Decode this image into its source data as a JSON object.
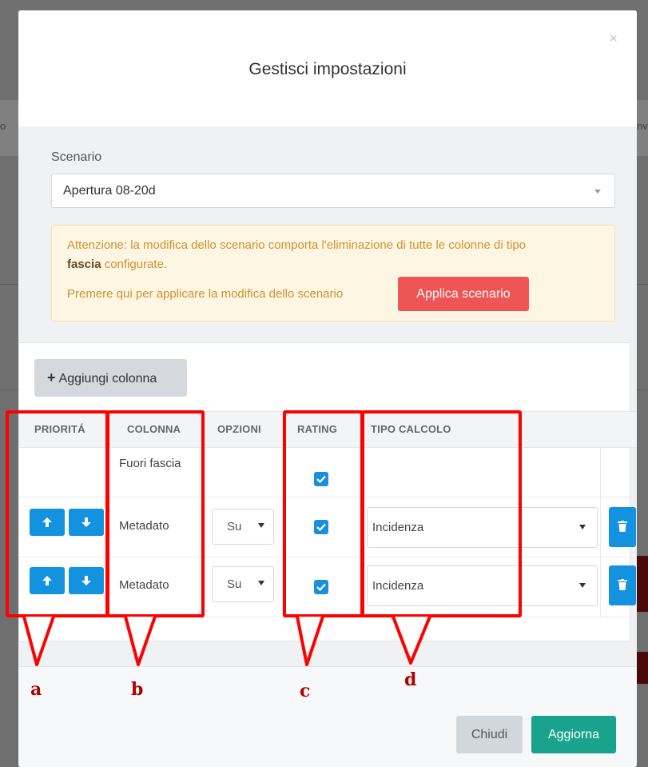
{
  "modal": {
    "title": "Gestisci impostazioni",
    "close_glyph": "×"
  },
  "scenario": {
    "label": "Scenario",
    "selected": "Apertura 08-20d"
  },
  "alert": {
    "text_before": "Attenzione: la modifica dello scenario comporta l'eliminazione di tutte le colonne di tipo",
    "bold_word": "fascia",
    "text_after": " configurate.",
    "apply_prompt": "Premere qui per applicare la modifica dello scenario",
    "apply_button": "Applica scenario"
  },
  "toolbar": {
    "add_column_label": "Aggiungi colonna"
  },
  "table": {
    "headers": [
      "PRIORITÁ",
      "COLONNA",
      "OPZIONI",
      "RATING",
      "TIPO CALCOLO"
    ],
    "rows": [
      {
        "column": "Fuori fascia",
        "option": "",
        "rating_checked": true,
        "calc_type": ""
      },
      {
        "column": "Metadato",
        "option": "Su",
        "rating_checked": true,
        "calc_type": "Incidenza"
      },
      {
        "column": "Metadato",
        "option": "Su",
        "rating_checked": true,
        "calc_type": "Incidenza"
      }
    ]
  },
  "footer": {
    "close_label": "Chiudi",
    "update_label": "Aggiorna"
  },
  "annotations": {
    "labels": [
      "a",
      "b",
      "c",
      "d"
    ],
    "color": "#ff0000"
  },
  "background": {
    "fragment_left": "o",
    "fragment_right": "nv"
  },
  "colors": {
    "primary_blue": "#1392e0",
    "danger_red": "#f05555",
    "success_teal": "#1aa38c",
    "warning_text": "#d2912f"
  }
}
